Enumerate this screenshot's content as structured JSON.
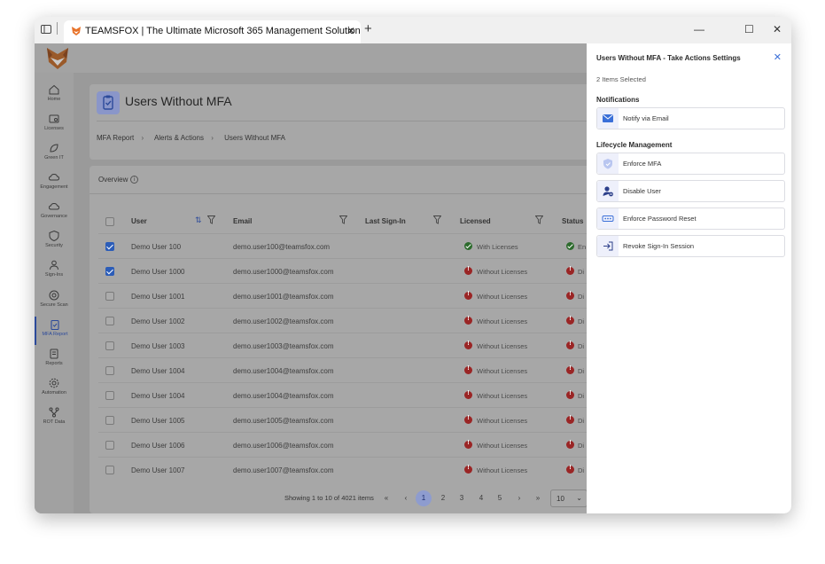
{
  "browser": {
    "tab_title": "TEAMSFOX | The Ultimate Microsoft 365 Management Solution",
    "tab_close": "✕",
    "new_tab": "+",
    "minimize": "—",
    "maximize": "☐",
    "close": "✕"
  },
  "sidebar": {
    "items": [
      {
        "label": "Home",
        "icon": "home-icon"
      },
      {
        "label": "Licenses",
        "icon": "license-icon"
      },
      {
        "label": "Green IT",
        "icon": "leaf-icon"
      },
      {
        "label": "Engagement",
        "icon": "cloud-icon"
      },
      {
        "label": "Governance",
        "icon": "cloud-icon"
      },
      {
        "label": "Security",
        "icon": "shield-icon"
      },
      {
        "label": "Sign-Ins",
        "icon": "user-icon"
      },
      {
        "label": "Secure Scan",
        "icon": "scan-icon"
      },
      {
        "label": "MFA Report",
        "icon": "clipboard-icon"
      },
      {
        "label": "Reports",
        "icon": "report-icon"
      },
      {
        "label": "Automation",
        "icon": "gear-icon"
      },
      {
        "label": "ROT Data",
        "icon": "data-icon"
      }
    ],
    "active_index": 8
  },
  "header": {
    "title": "Users Without MFA",
    "breadcrumb": [
      "MFA Report",
      "Alerts & Actions",
      "Users Without MFA"
    ],
    "breadcrumb_sep": "›"
  },
  "table": {
    "overview_label": "Overview",
    "info_glyph": "i",
    "columns": {
      "user": "User",
      "email": "Email",
      "last_sign_in": "Last Sign-In",
      "licensed": "Licensed",
      "status": "Status"
    },
    "sort_glyph": "⇅",
    "rows": [
      {
        "user": "Demo User 100",
        "email": "demo.user100@teamsfox.com",
        "last_sign_in": "",
        "licensed": "With Licenses",
        "licensed_ok": true,
        "status_text": "En",
        "checked": true
      },
      {
        "user": "Demo User 1000",
        "email": "demo.user1000@teamsfox.com",
        "last_sign_in": "",
        "licensed": "Without Licenses",
        "licensed_ok": false,
        "status_text": "Di",
        "checked": true
      },
      {
        "user": "Demo User 1001",
        "email": "demo.user1001@teamsfox.com",
        "last_sign_in": "",
        "licensed": "Without Licenses",
        "licensed_ok": false,
        "status_text": "Di",
        "checked": false
      },
      {
        "user": "Demo User 1002",
        "email": "demo.user1002@teamsfox.com",
        "last_sign_in": "",
        "licensed": "Without Licenses",
        "licensed_ok": false,
        "status_text": "Di",
        "checked": false
      },
      {
        "user": "Demo User 1003",
        "email": "demo.user1003@teamsfox.com",
        "last_sign_in": "",
        "licensed": "Without Licenses",
        "licensed_ok": false,
        "status_text": "Di",
        "checked": false
      },
      {
        "user": "Demo User 1004",
        "email": "demo.user1004@teamsfox.com",
        "last_sign_in": "",
        "licensed": "Without Licenses",
        "licensed_ok": false,
        "status_text": "Di",
        "checked": false
      },
      {
        "user": "Demo User 1004",
        "email": "demo.user1004@teamsfox.com",
        "last_sign_in": "",
        "licensed": "Without Licenses",
        "licensed_ok": false,
        "status_text": "Di",
        "checked": false
      },
      {
        "user": "Demo User 1005",
        "email": "demo.user1005@teamsfox.com",
        "last_sign_in": "",
        "licensed": "Without Licenses",
        "licensed_ok": false,
        "status_text": "Di",
        "checked": false
      },
      {
        "user": "Demo User 1006",
        "email": "demo.user1006@teamsfox.com",
        "last_sign_in": "",
        "licensed": "Without Licenses",
        "licensed_ok": false,
        "status_text": "Di",
        "checked": false
      },
      {
        "user": "Demo User 1007",
        "email": "demo.user1007@teamsfox.com",
        "last_sign_in": "",
        "licensed": "Without Licenses",
        "licensed_ok": false,
        "status_text": "Di",
        "checked": false
      }
    ]
  },
  "pagination": {
    "info": "Showing 1 to 10 of 4021 items",
    "first": "«",
    "prev": "‹",
    "pages": [
      "1",
      "2",
      "3",
      "4",
      "5"
    ],
    "current": "1",
    "next": "›",
    "last": "»",
    "page_size": "10",
    "page_size_chevron": "⌄"
  },
  "panel": {
    "title": "Users Without MFA - Take Actions Settings",
    "close": "✕",
    "selected": "2 Items Selected",
    "notifications_heading": "Notifications",
    "notify_email": "Notify via Email",
    "lifecycle_heading": "Lifecycle Management",
    "actions": [
      "Enforce MFA",
      "Disable User",
      "Enforce Password Reset",
      "Revoke Sign-In Session"
    ]
  },
  "colors": {
    "accent": "#3a6fd8",
    "overlay": "#9a9a9a",
    "ok": "#2d6b2d",
    "error": "#9a2525"
  }
}
